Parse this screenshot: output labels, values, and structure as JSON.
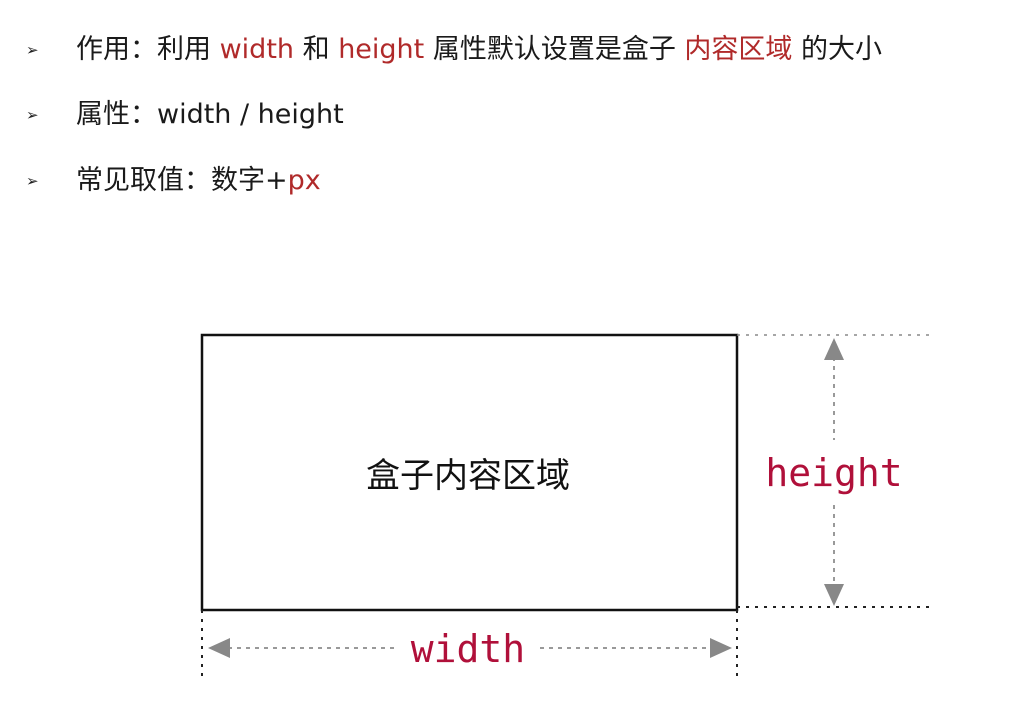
{
  "bullets": {
    "marker": "➢",
    "line1": {
      "prefix": "作用：利用 ",
      "width_word": "width",
      "and": " 和 ",
      "height_word": "height",
      "middle": " 属性默认设置是盒子 ",
      "content_area": "内容区域",
      "suffix": " 的大小"
    },
    "line2": {
      "text": "属性：width / height"
    },
    "line3": {
      "prefix": "常见取值：数字+",
      "unit": "px"
    }
  },
  "diagram": {
    "box_label": "盒子内容区域",
    "height_label": "height",
    "width_label": "width"
  },
  "colors": {
    "highlight": "#b02a2a",
    "dimension_label": "#b0103a",
    "guide": "#888888"
  }
}
